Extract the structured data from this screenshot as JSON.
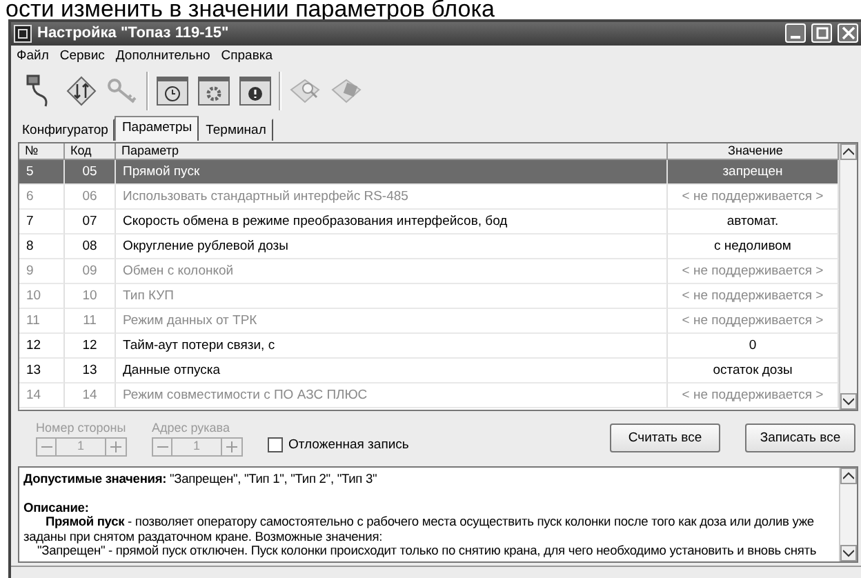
{
  "caption_above": "ости изменить в значении параметров блока",
  "window": {
    "title": "Настройка \"Топаз 119-15\""
  },
  "menu": [
    "Файл",
    "Сервис",
    "Дополнительно",
    "Справка"
  ],
  "toolbar": [
    {
      "kind": "plug",
      "disabled": false
    },
    {
      "kind": "exchange",
      "disabled": false
    },
    {
      "kind": "key",
      "disabled": true
    },
    {
      "kind": "clock",
      "disabled": false
    },
    {
      "kind": "gear",
      "disabled": false
    },
    {
      "kind": "alert",
      "disabled": false
    },
    {
      "kind": "search",
      "disabled": true
    },
    {
      "kind": "save",
      "disabled": true
    }
  ],
  "tabs": [
    {
      "label": "Конфигуратор",
      "selected": false
    },
    {
      "label": "Параметры",
      "selected": true
    },
    {
      "label": "Терминал",
      "selected": false
    }
  ],
  "table": {
    "columns": [
      "№",
      "Код",
      "Параметр",
      "Значение"
    ],
    "rows": [
      {
        "num": "5",
        "code": "05",
        "param": "Прямой пуск",
        "value": "запрещен",
        "supported": true,
        "selected": true
      },
      {
        "num": "6",
        "code": "06",
        "param": "Использовать стандартный интерфейс RS-485",
        "value": "< не поддерживается >",
        "supported": false,
        "selected": false
      },
      {
        "num": "7",
        "code": "07",
        "param": "Скорость обмена в режиме преобразования интерфейсов, бод",
        "value": "автомат.",
        "supported": true,
        "selected": false
      },
      {
        "num": "8",
        "code": "08",
        "param": "Округление рублевой дозы",
        "value": "с недоливом",
        "supported": true,
        "selected": false
      },
      {
        "num": "9",
        "code": "09",
        "param": "Обмен с колонкой",
        "value": "< не поддерживается >",
        "supported": false,
        "selected": false
      },
      {
        "num": "10",
        "code": "10",
        "param": "Тип КУП",
        "value": "< не поддерживается >",
        "supported": false,
        "selected": false
      },
      {
        "num": "11",
        "code": "11",
        "param": "Режим данных от ТРК",
        "value": "< не поддерживается >",
        "supported": false,
        "selected": false
      },
      {
        "num": "12",
        "code": "12",
        "param": "Тайм-аут потери связи, с",
        "value": "0",
        "supported": true,
        "selected": false
      },
      {
        "num": "13",
        "code": "13",
        "param": "Данные отпуска",
        "value": "остаток дозы",
        "supported": true,
        "selected": false
      },
      {
        "num": "14",
        "code": "14",
        "param": "Режим совместимости с ПО АЗС ПЛЮС",
        "value": "< не поддерживается >",
        "supported": false,
        "selected": false
      }
    ]
  },
  "spinners": [
    {
      "label": "Номер стороны",
      "value": "1",
      "disabled": true
    },
    {
      "label": "Адрес рукава",
      "value": "1",
      "disabled": true
    }
  ],
  "deferred_write": {
    "label": "Отложенная запись",
    "checked": false
  },
  "buttons": [
    "Считать все",
    "Записать все"
  ],
  "description": [
    {
      "kind": "line",
      "text": "**Допустимые значения:** \"Запрещен\", \"Тип 1\", \"Тип 2\", \"Тип 3\""
    },
    {
      "kind": "gap"
    },
    {
      "kind": "line",
      "text": "**Описание:**"
    },
    {
      "kind": "indent",
      "text": "**Прямой пуск** - позволяет оператору самостоятельно с рабочего места осуществить пуск колонки после того как доза или долив уже заданы при снятом раздаточном кране. Возможные значения:"
    },
    {
      "kind": "indent-small",
      "text": "\"Запрещен\" - прямой пуск отключен. Пуск колонки происходит только по снятию крана, для чего необходимо установить и вновь снять"
    }
  ]
}
